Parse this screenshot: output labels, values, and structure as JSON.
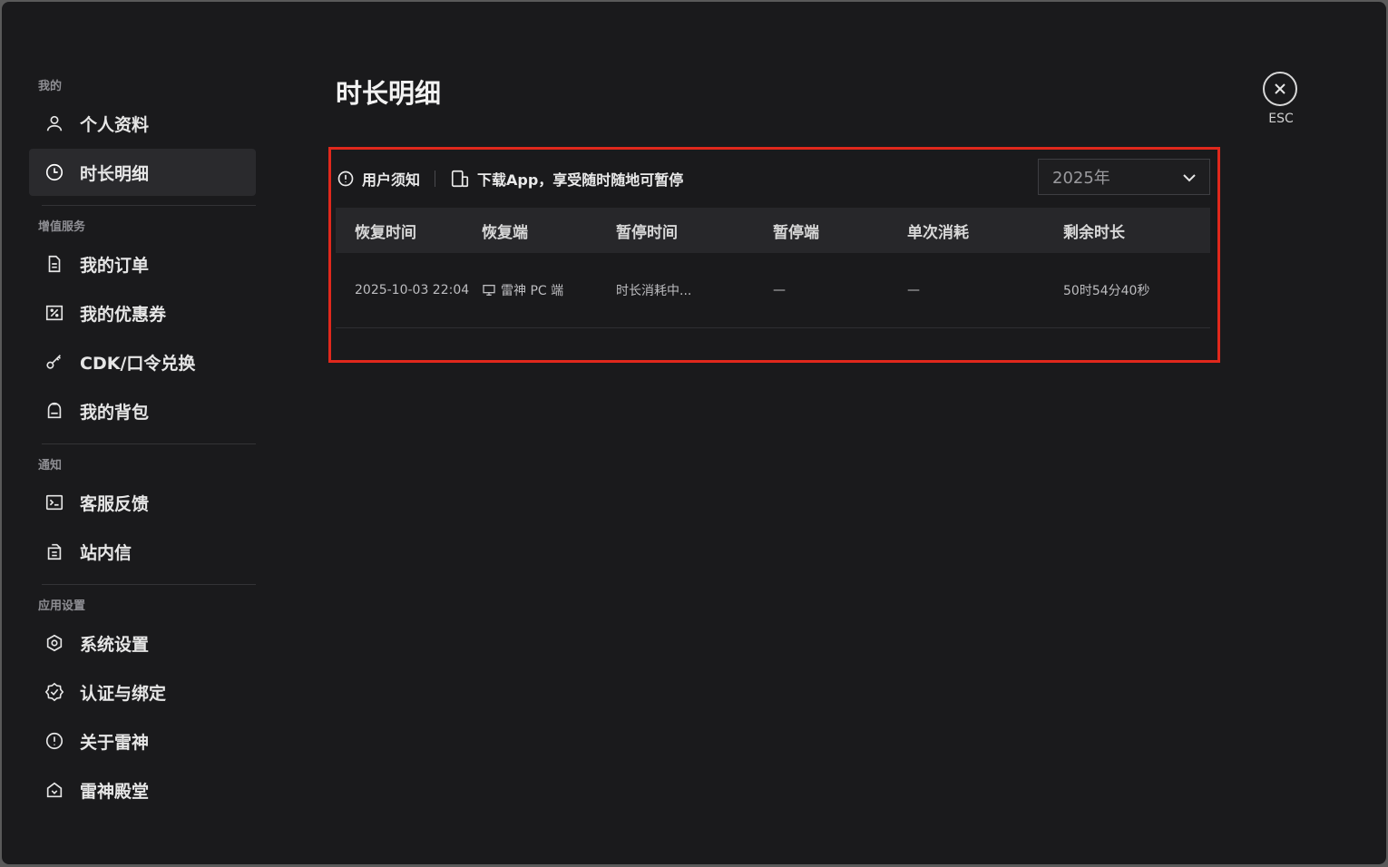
{
  "sidebar": {
    "sections": [
      {
        "title": "我的"
      },
      {
        "title": "增值服务"
      },
      {
        "title": "通知"
      },
      {
        "title": "应用设置"
      }
    ],
    "items": {
      "profile": "个人资料",
      "duration": "时长明细",
      "orders": "我的订单",
      "coupons": "我的优惠券",
      "cdk": "CDK/口令兑换",
      "backpack": "我的背包",
      "feedback": "客服反馈",
      "messages": "站内信",
      "system": "系统设置",
      "auth": "认证与绑定",
      "about": "关于雷神",
      "hall": "雷神殿堂"
    },
    "active": "duration"
  },
  "main": {
    "title": "时长明细",
    "esc_label": "ESC",
    "toolbar": {
      "notice": "用户须知",
      "download": "下载App，享受随时随地可暂停",
      "year_selected": "2025年"
    },
    "table": {
      "headers": [
        "恢复时间",
        "恢复端",
        "暂停时间",
        "暂停端",
        "单次消耗",
        "剩余时长"
      ],
      "rows": [
        {
          "resume_time": "2025-10-03 22:04",
          "resume_client": "雷神 PC 端",
          "pause_time": "时长消耗中...",
          "pause_client": "—",
          "single_cost": "—",
          "remaining": "50时54分40秒"
        }
      ]
    }
  },
  "colors": {
    "background": "#1a1a1c",
    "highlight_border": "#e0281c",
    "active_item": "#2a2a2d"
  }
}
